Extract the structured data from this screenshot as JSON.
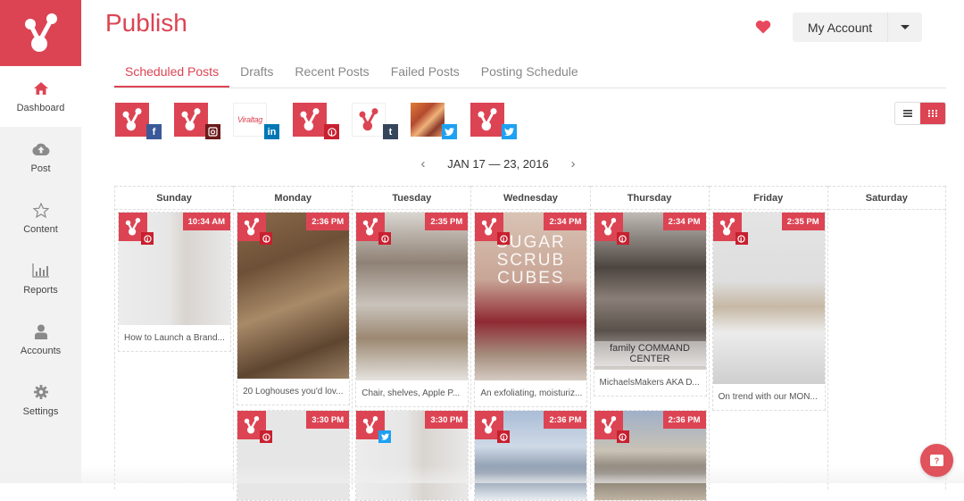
{
  "app": {
    "title": "Publish",
    "brand_color": "#dc4453"
  },
  "header": {
    "account_label": "My Account",
    "favorite_icon": "heart-icon"
  },
  "sidebar": {
    "items": [
      {
        "label": "Dashboard",
        "icon": "home-icon",
        "active": true
      },
      {
        "label": "Post",
        "icon": "cloud-upload-icon"
      },
      {
        "label": "Content",
        "icon": "star-icon"
      },
      {
        "label": "Reports",
        "icon": "bar-chart-icon"
      },
      {
        "label": "Accounts",
        "icon": "user-icon"
      },
      {
        "label": "Settings",
        "icon": "gear-icon"
      }
    ]
  },
  "tabs": [
    {
      "label": "Scheduled Posts",
      "active": true
    },
    {
      "label": "Drafts"
    },
    {
      "label": "Recent Posts"
    },
    {
      "label": "Failed Posts"
    },
    {
      "label": "Posting Schedule"
    }
  ],
  "accounts": [
    {
      "network": "facebook",
      "badge": "f",
      "color": "#3b5998"
    },
    {
      "network": "instagram",
      "badge": "◘",
      "color": "#6b1a1a"
    },
    {
      "network": "linkedin",
      "badge": "in",
      "color": "#0077b5",
      "avatar_text": "Viraltag"
    },
    {
      "network": "pinterest",
      "badge": "P",
      "color": "#c8202f"
    },
    {
      "network": "tumblr",
      "badge": "t",
      "color": "#35465c"
    },
    {
      "network": "twitter",
      "badge": "🐦",
      "color": "#1da1f2"
    },
    {
      "network": "twitter",
      "badge": "🐦",
      "color": "#1da1f2"
    }
  ],
  "view": {
    "list_label": "list-view",
    "grid_label": "calendar-view",
    "active": "grid"
  },
  "date_range": {
    "label": "JAN 17 — 23, 2016",
    "prev": "‹",
    "next": "›"
  },
  "calendar": {
    "days": [
      "Sunday",
      "Monday",
      "Tuesday",
      "Wednesday",
      "Thursday",
      "Friday",
      "Saturday"
    ],
    "posts": [
      {
        "day": 0,
        "time": "10:34 AM",
        "caption": "How to Launch a Brand...",
        "network": "pinterest"
      },
      {
        "day": 1,
        "time": "2:36 PM",
        "caption": "20 Loghouses you'd lov...",
        "network": "pinterest"
      },
      {
        "day": 2,
        "time": "2:35 PM",
        "caption": "Chair, shelves, Apple P...",
        "network": "pinterest"
      },
      {
        "day": 3,
        "time": "2:34 PM",
        "caption": "An exfoliating, moisturiz...",
        "network": "pinterest",
        "overlay": "SUGAR SCRUB CUBES"
      },
      {
        "day": 4,
        "time": "2:34 PM",
        "caption": "MichaelsMakers AKA D...",
        "network": "pinterest",
        "overlay": "family COMMAND CENTER"
      },
      {
        "day": 5,
        "time": "2:35 PM",
        "caption": "On trend with our MON...",
        "network": "pinterest"
      },
      {
        "day": 1,
        "time": "3:30 PM",
        "caption": "",
        "network": "pinterest"
      },
      {
        "day": 2,
        "time": "3:30 PM",
        "caption": "",
        "network": "twitter"
      },
      {
        "day": 3,
        "time": "2:36 PM",
        "caption": "",
        "network": "pinterest"
      },
      {
        "day": 4,
        "time": "2:36 PM",
        "caption": "",
        "network": "pinterest"
      }
    ]
  },
  "help": {
    "label": "?"
  }
}
